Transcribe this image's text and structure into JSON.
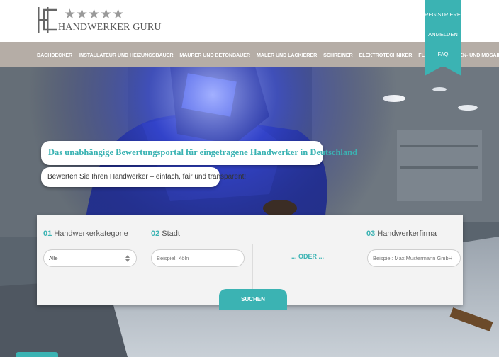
{
  "logo": {
    "text": "HANDWERKER GURU",
    "stars": "★★★★★"
  },
  "nav": {
    "items": [
      {
        "label": "DACHDECKER"
      },
      {
        "label": "INSTALLATEUR UND HEIZUNGSBAUER"
      },
      {
        "label": "MAURER UND BETONBAUER"
      },
      {
        "label": "MALER UND LACKIERER"
      },
      {
        "label": "SCHREINER"
      },
      {
        "label": "ELEKTROTECHNIKER"
      },
      {
        "label": "FLIESEN-, PLATTEN- UND MOSAIKLEGER"
      }
    ]
  },
  "ribbon": {
    "register": "REGISTRIEREN",
    "login": "ANMELDEN",
    "faq": "FAQ"
  },
  "hero": {
    "tagline": "Das unabhängige Bewertungsportal für eingetragene Handwerker in Deutschland",
    "subtagline": "Bewerten Sie Ihren Handwerker – einfach, fair und transparent!"
  },
  "search": {
    "col1": {
      "num": "01",
      "label": "Handwerkerkategorie",
      "value": "Alle"
    },
    "col2": {
      "num": "02",
      "label": "Stadt",
      "placeholder": "Beispiel: Köln"
    },
    "col3": {
      "num": "03",
      "label": "Handwerkerfirma",
      "placeholder": "Beispiel: Max Mustermann GmbH"
    },
    "or_text": "... ODER ...",
    "button_label": "SUCHEN"
  },
  "colors": {
    "accent": "#3bb3b3",
    "nav_bg": "#b5ada6"
  }
}
